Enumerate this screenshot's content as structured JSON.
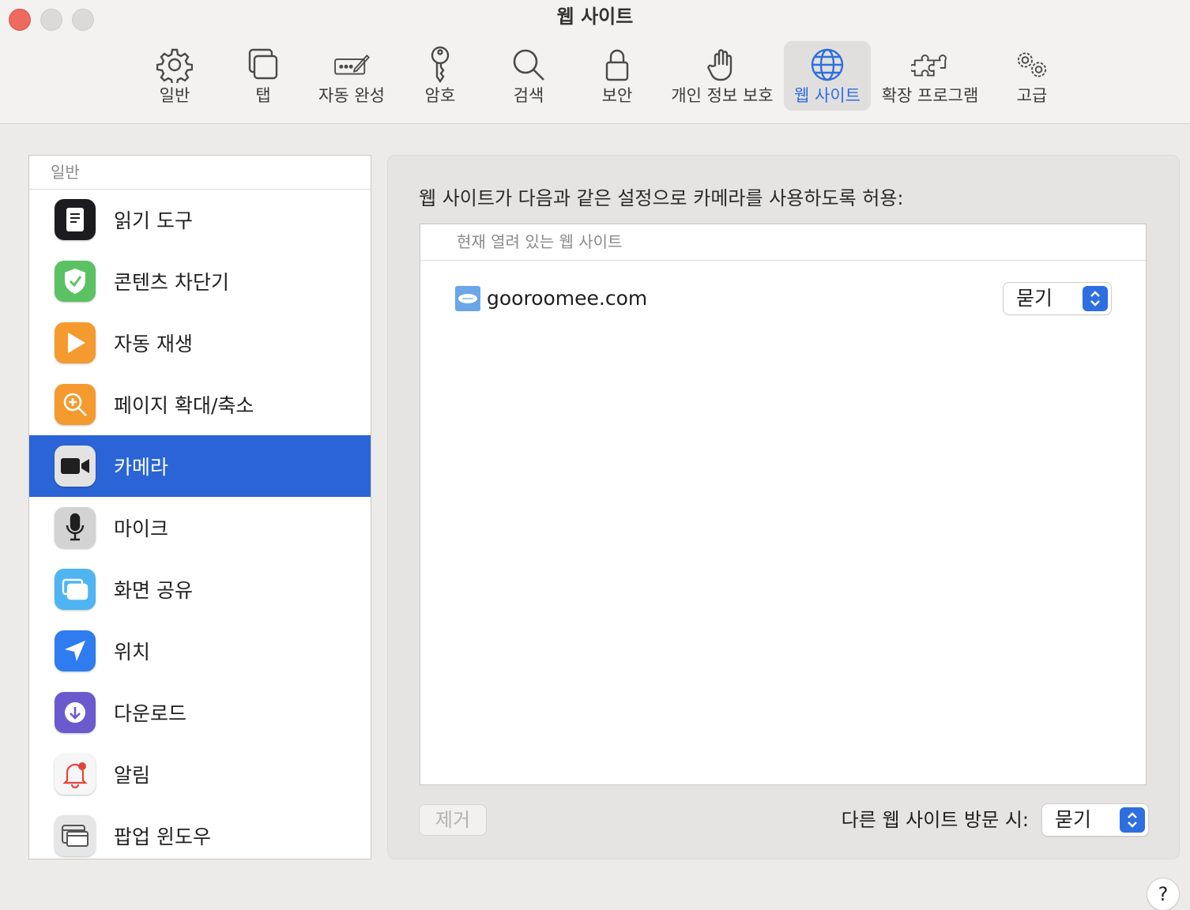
{
  "window": {
    "title": "웹 사이트"
  },
  "toolbar": {
    "items": [
      {
        "label": "일반",
        "icon": "gear-icon"
      },
      {
        "label": "탭",
        "icon": "tabs-icon"
      },
      {
        "label": "자동 완성",
        "icon": "autofill-icon"
      },
      {
        "label": "암호",
        "icon": "key-icon"
      },
      {
        "label": "검색",
        "icon": "magnifier-icon"
      },
      {
        "label": "보안",
        "icon": "lock-icon"
      },
      {
        "label": "개인 정보 보호",
        "icon": "hand-icon"
      },
      {
        "label": "웹 사이트",
        "icon": "globe-icon",
        "active": true
      },
      {
        "label": "확장 프로그램",
        "icon": "puzzle-icon"
      },
      {
        "label": "고급",
        "icon": "gears-icon"
      }
    ]
  },
  "sidebar": {
    "header": "일반",
    "items": [
      {
        "label": "읽기 도구",
        "icon": "reader-icon"
      },
      {
        "label": "콘텐츠 차단기",
        "icon": "shield-check-icon"
      },
      {
        "label": "자동 재생",
        "icon": "play-icon"
      },
      {
        "label": "페이지 확대/축소",
        "icon": "zoom-icon"
      },
      {
        "label": "카메라",
        "icon": "camera-icon",
        "selected": true
      },
      {
        "label": "마이크",
        "icon": "microphone-icon"
      },
      {
        "label": "화면 공유",
        "icon": "screen-share-icon"
      },
      {
        "label": "위치",
        "icon": "location-arrow-icon"
      },
      {
        "label": "다운로드",
        "icon": "download-icon"
      },
      {
        "label": "알림",
        "icon": "bell-icon"
      },
      {
        "label": "팝업 윈도우",
        "icon": "popup-window-icon"
      }
    ]
  },
  "panel": {
    "description": "웹 사이트가 다음과 같은 설정으로 카메라를 사용하도록 허용:",
    "table_header": "현재 열려 있는 웹 사이트",
    "sites": [
      {
        "name": "gooroomee.com",
        "setting": "묻기"
      }
    ],
    "remove_button": "제거",
    "other_sites_label": "다른 웹 사이트 방문 시:",
    "other_sites_setting": "묻기"
  },
  "help": {
    "label": "?"
  },
  "colors": {
    "accent": "#2d6fe0",
    "selection": "#2a64d6",
    "close": "#ee6a5f"
  }
}
